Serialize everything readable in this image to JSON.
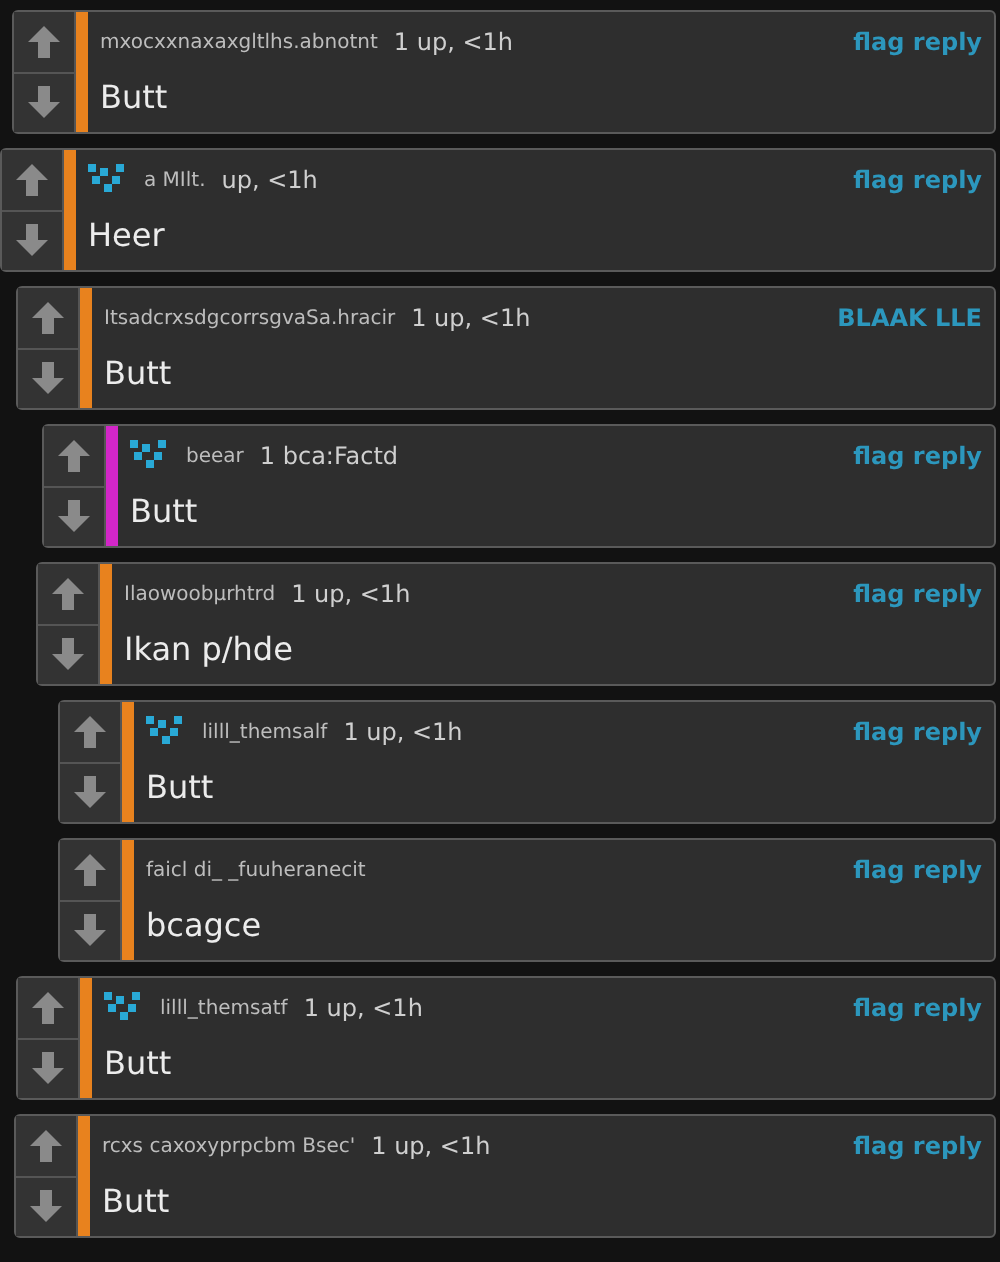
{
  "comments": [
    {
      "avatar": false,
      "username": "mxocxxnaxaxgltlhs.abnotnt",
      "meta": "1 up, <1h",
      "links": "flag reply",
      "body": "Butt",
      "color": "#e8821e"
    },
    {
      "avatar": true,
      "username": "a MIlt.",
      "meta": "up, <1h",
      "links": "flag reply",
      "body": "Heer",
      "color": "#e8821e"
    },
    {
      "avatar": false,
      "username": "ItsadcrxsdgcorrsgvaSa.hracir",
      "meta": "1 up, <1h",
      "links": "BLAAK LLE",
      "body": "Butt",
      "color": "#e8821e"
    },
    {
      "avatar": true,
      "username": "beear",
      "meta": "1 bca:Factd",
      "links": "flag reply",
      "body": "Butt",
      "color": "#d326c8"
    },
    {
      "avatar": false,
      "username": "Ilaowoobµrhtrd",
      "meta": "1 up, <1h",
      "links": "flag reply",
      "body": "Ikan p/hde",
      "color": "#e8821e"
    },
    {
      "avatar": true,
      "username": "lilll_themsalf",
      "meta": "1 up, <1h",
      "links": "flag reply",
      "body": "Butt",
      "color": "#e8821e"
    },
    {
      "avatar": false,
      "username": "faicl di_ _fuuheranecit",
      "links": "flag reply",
      "body": "bcagce",
      "color": "#e8821e"
    },
    {
      "avatar": true,
      "username": "lilll_themsatf",
      "meta": "1 up, <1h",
      "links": "flag reply",
      "body": "Butt",
      "color": "#e8821e"
    },
    {
      "avatar": false,
      "username": "rcxs caxoxyprpcbm Bsec'",
      "meta": "1 up, <1h",
      "links": "flag reply",
      "body": "Butt",
      "color": "#e8821e"
    }
  ]
}
